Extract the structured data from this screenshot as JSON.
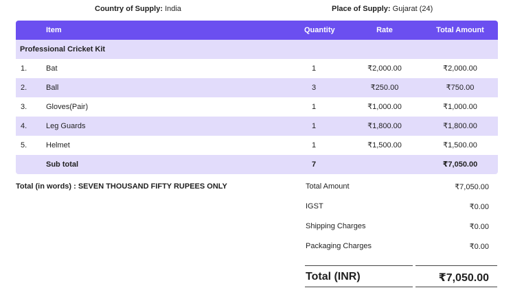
{
  "supply": {
    "country_label": "Country of Supply:",
    "country_value": "India",
    "place_label": "Place of Supply:",
    "place_value": "Gujarat (24)"
  },
  "table": {
    "headers": {
      "item": "Item",
      "quantity": "Quantity",
      "rate": "Rate",
      "total": "Total Amount"
    },
    "section": "Professional Cricket Kit",
    "rows": [
      {
        "num": "1.",
        "item": "Bat",
        "qty": "1",
        "rate": "₹2,000.00",
        "total": "₹2,000.00"
      },
      {
        "num": "2.",
        "item": "Ball",
        "qty": "3",
        "rate": "₹250.00",
        "total": "₹750.00"
      },
      {
        "num": "3.",
        "item": "Gloves(Pair)",
        "qty": "1",
        "rate": "₹1,000.00",
        "total": "₹1,000.00"
      },
      {
        "num": "4.",
        "item": "Leg Guards",
        "qty": "1",
        "rate": "₹1,800.00",
        "total": "₹1,800.00"
      },
      {
        "num": "5.",
        "item": "Helmet",
        "qty": "1",
        "rate": "₹1,500.00",
        "total": "₹1,500.00"
      }
    ],
    "subtotal": {
      "label": "Sub total",
      "qty": "7",
      "total": "₹7,050.00"
    }
  },
  "words": "Total (in words) : SEVEN THOUSAND FIFTY RUPEES ONLY",
  "summary": [
    {
      "label": "Total Amount",
      "value": "₹7,050.00"
    },
    {
      "label": "IGST",
      "value": "₹0.00"
    },
    {
      "label": "Shipping Charges",
      "value": "₹0.00"
    },
    {
      "label": "Packaging Charges",
      "value": "₹0.00"
    }
  ],
  "grand_total": {
    "label": "Total (INR)",
    "value": "₹7,050.00"
  },
  "colors": {
    "header": "#6b4ff0",
    "band": "#e2dcfb"
  }
}
